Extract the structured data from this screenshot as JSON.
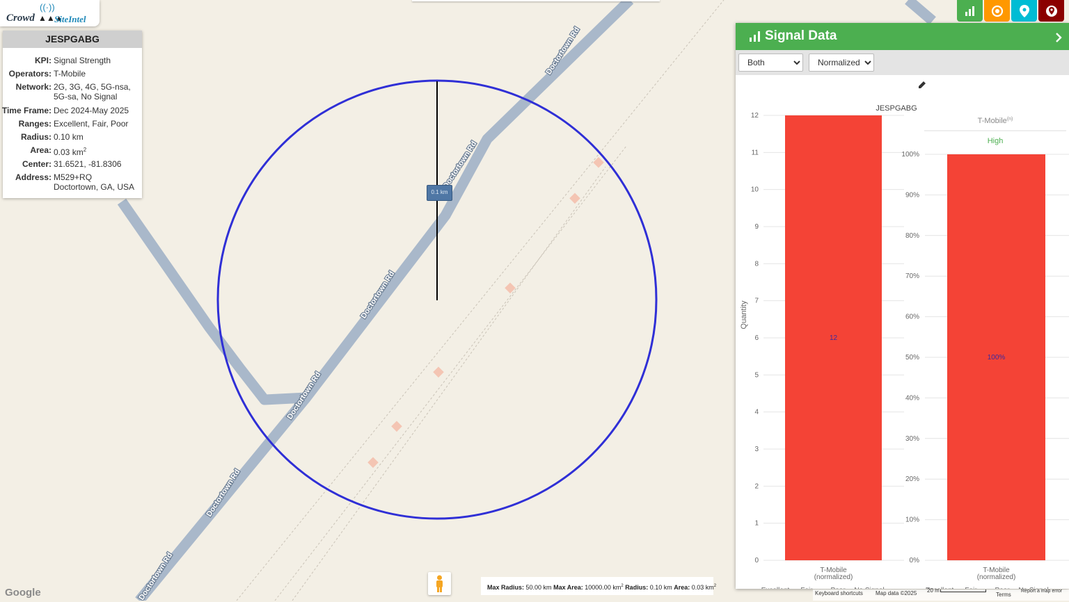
{
  "app": {
    "logo_word1": "Crowd",
    "logo_word2": "SiteIntel",
    "logo_antenna": "((·))",
    "logo_towers": "▲▲▲"
  },
  "colors": {
    "panel_header": "#4caf50",
    "poor": "#f44336",
    "excellent": "#4caf50",
    "fair": "#ffeb3b",
    "no_signal": "#bdbdbd",
    "circle": "#2f2fd6",
    "road": "#a9b8ca"
  },
  "info": {
    "title": "JESPGABG",
    "rows": [
      {
        "key": "KPI:",
        "value": "Signal Strength"
      },
      {
        "key": "Operators:",
        "value": "T-Mobile"
      },
      {
        "key": "Network:",
        "value": "2G, 3G, 4G, 5G-nsa, 5G-sa, No Signal"
      },
      {
        "key": "Time Frame:",
        "value": "Dec 2024-May 2025"
      },
      {
        "key": "Ranges:",
        "value": "Excellent, Fair, Poor"
      },
      {
        "key": "Radius:",
        "value": "0.10 km"
      },
      {
        "key": "Area:",
        "value": "0.03 km",
        "sup": "2"
      },
      {
        "key": "Center:",
        "value": "31.6521, -81.8306"
      },
      {
        "key": "Address:",
        "value": "M529+RQ Doctortown, GA, USA"
      }
    ]
  },
  "top_buttons": [
    {
      "icon": "bar-chart-icon",
      "color": "#4caf50"
    },
    {
      "icon": "target-icon",
      "color": "#ff9800"
    },
    {
      "icon": "map-pin-icon",
      "color": "#00bcd4"
    },
    {
      "icon": "globe-pin-icon",
      "color": "#8b0000"
    }
  ],
  "map": {
    "roads": [
      {
        "label": "Doctortown Rd"
      },
      {
        "label": "Doctortown Rd"
      },
      {
        "label": "Doctortown Rd"
      },
      {
        "label": "Doctortown Rd"
      },
      {
        "label": "Doctortown Rd"
      },
      {
        "label": "Doctortown Rd"
      }
    ],
    "radius_label": "0.1 km"
  },
  "panel": {
    "title": "Signal Data",
    "mode_select": {
      "selected": "Both",
      "options": [
        "Both"
      ]
    },
    "scale_select": {
      "selected": "Normalized",
      "options": [
        "Normalized"
      ]
    },
    "collapse_icon": "chevron-right-icon"
  },
  "chart_data": [
    {
      "type": "bar",
      "title": "JESPGABG",
      "categories": [
        "T-Mobile (normalized)"
      ],
      "category_lines": [
        "T-Mobile",
        "(normalized)"
      ],
      "series": [
        {
          "name": "Poor",
          "values": [
            12
          ]
        }
      ],
      "data_labels": [
        "12"
      ],
      "ylabel": "Quantity",
      "ylim": [
        0,
        12
      ],
      "yticks": [
        "0",
        "1",
        "2",
        "3",
        "4",
        "5",
        "6",
        "7",
        "8",
        "9",
        "10",
        "11",
        "12"
      ],
      "grid": true,
      "legend": [
        "Excellent",
        "Fair",
        "Poor",
        "No Signal"
      ],
      "legend_placement": "bottom"
    },
    {
      "type": "bar",
      "title": "T-Mobile",
      "title_sup": "(n)",
      "subtitle": "High",
      "categories": [
        "T-Mobile (normalized)"
      ],
      "category_lines": [
        "T-Mobile",
        "(normalized)"
      ],
      "series": [
        {
          "name": "Poor",
          "values": [
            100
          ]
        }
      ],
      "data_labels": [
        "100%"
      ],
      "ylim": [
        0,
        100
      ],
      "yticks": [
        "0%",
        "10%",
        "20%",
        "30%",
        "40%",
        "50%",
        "60%",
        "70%",
        "80%",
        "90%",
        "100%"
      ],
      "grid": true,
      "legend": [
        "Excellent",
        "Fair",
        "Poor",
        "No Signal"
      ],
      "legend_placement": "bottom"
    }
  ],
  "status": {
    "max_radius_label": "Max Radius:",
    "max_radius": "50.00 km",
    "max_area_label": "Max Area:",
    "max_area": "10000.00 km",
    "max_area_sup": "2",
    "radius_label": "Radius:",
    "radius": "0.10 km",
    "area_label": "Area:",
    "area": "0.03 km",
    "area_sup": "2"
  },
  "attribution": {
    "google": "Google",
    "shortcuts": "Keyboard shortcuts",
    "mapdata": "Map data ©2025",
    "scale": "20 m",
    "terms": "Terms",
    "report": "Report a map error"
  }
}
